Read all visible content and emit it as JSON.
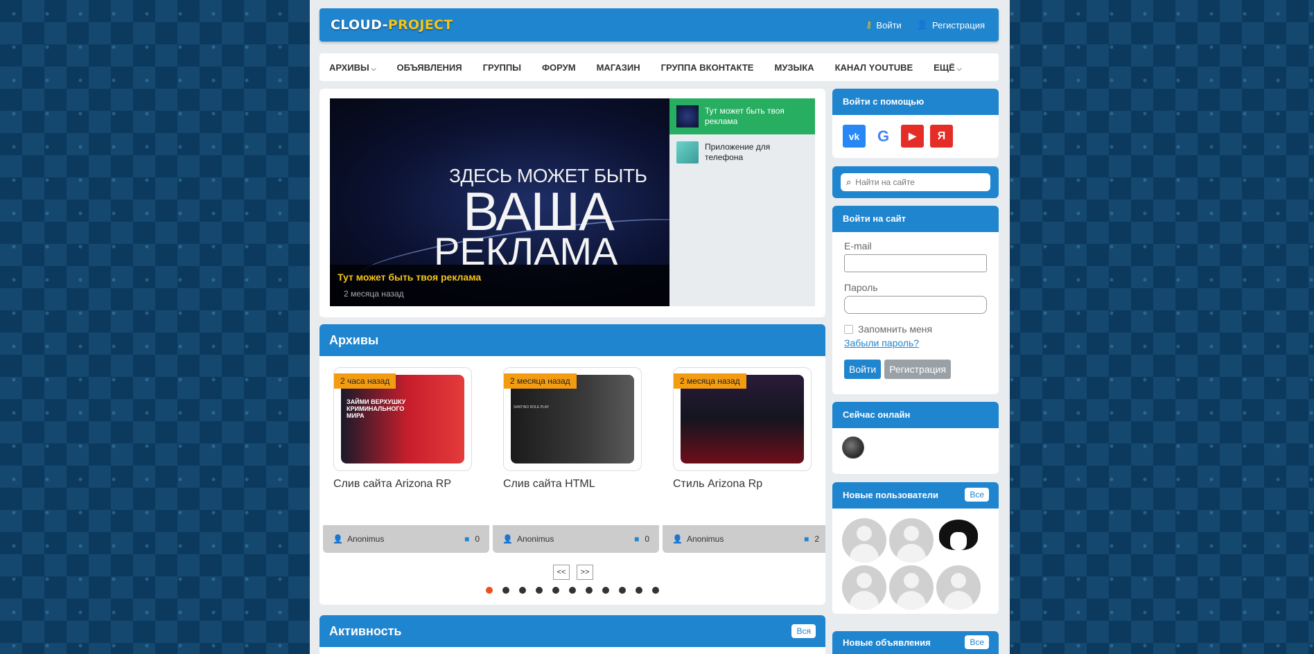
{
  "header": {
    "logo_part1": "CLOUD-",
    "logo_part2": "PROJECT",
    "login_label": "Войти",
    "register_label": "Регистрация"
  },
  "nav": {
    "items": [
      {
        "label": "АРХИВЫ",
        "has_dropdown": true
      },
      {
        "label": "ОБЪЯВЛЕНИЯ"
      },
      {
        "label": "ГРУППЫ"
      },
      {
        "label": "ФОРУМ"
      },
      {
        "label": "МАГАЗИН"
      },
      {
        "label": "ГРУППА ВКОНТАКТЕ"
      },
      {
        "label": "МУЗЫКА"
      },
      {
        "label": "КАНАЛ YOUTUBE"
      },
      {
        "label": "ЕЩЁ",
        "has_dropdown": true
      }
    ]
  },
  "slider": {
    "image_text_line1": "ЗДЕСЬ МОЖЕТ БЫТЬ",
    "image_text_line2": "ВАША",
    "image_text_line3": "РЕКЛАМА",
    "caption_title": "Тут может быть твоя реклама",
    "caption_date": "2 месяца назад",
    "list": [
      {
        "label": "Тут может быть твоя реклама",
        "active": true
      },
      {
        "label": "Приложение для телефона",
        "active": false
      }
    ]
  },
  "archives": {
    "title": "Архивы",
    "items": [
      {
        "badge": "2 часа назад",
        "title": "Слив сайта Arizona RP",
        "author": "Anonimus",
        "comments": "0",
        "thumb_text": "ЗАЙМИ ВЕРХУШКУ КРИМИНАЛЬНОГО МИРА"
      },
      {
        "badge": "2 месяца назад",
        "title": "Слив сайта HTML",
        "author": "Anonimus",
        "comments": "0",
        "thumb_text": "SANTINO ROLE PLAY"
      },
      {
        "badge": "2 месяца назад",
        "title": "Стиль Arizona Rp",
        "author": "Anonimus",
        "comments": "2",
        "thumb_text": ""
      }
    ],
    "prev_label": "<<",
    "next_label": ">>",
    "dots_count": 11,
    "active_dot": 0
  },
  "activity": {
    "title": "Активность",
    "all_label": "Вся"
  },
  "sidebar": {
    "social_title": "Войти с помощью",
    "social": [
      {
        "name": "vk-icon",
        "glyph": "vk",
        "color": "#2787f5"
      },
      {
        "name": "google-icon",
        "glyph": "G",
        "color": "#ffffff"
      },
      {
        "name": "youtube-icon",
        "glyph": "▶",
        "color": "#e52d27"
      },
      {
        "name": "yandex-icon",
        "glyph": "Я",
        "color": "#e52d27"
      }
    ],
    "search_placeholder": "Найти на сайте",
    "login_title": "Войти на сайт",
    "email_label": "E-mail",
    "password_label": "Пароль",
    "remember_label": "Запомнить меня",
    "forgot_label": "Забыли пароль?",
    "login_button": "Войти",
    "register_button": "Регистрация",
    "online_title": "Сейчас онлайн",
    "new_users_title": "Новые пользователи",
    "new_users_all": "Все",
    "new_ads_title": "Новые объявления",
    "new_ads_all": "Все"
  },
  "colors": {
    "accent": "#2085cf",
    "logo_yellow": "#f5c518",
    "active_green": "#27ae60",
    "badge_orange": "#f39c12",
    "dot_active": "#e8501d"
  }
}
